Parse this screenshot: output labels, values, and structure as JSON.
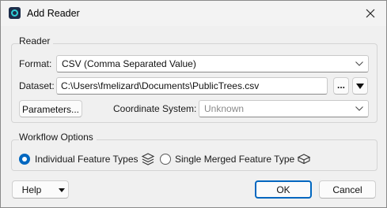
{
  "window": {
    "title": "Add Reader",
    "close_icon": "close-icon",
    "app_icon": "fme-app-icon"
  },
  "reader": {
    "group_label": "Reader",
    "format_label": "Format:",
    "format_value": "CSV (Comma Separated Value)",
    "dataset_label": "Dataset:",
    "dataset_value": "C:\\Users\\fmelizard\\Documents\\PublicTrees.csv",
    "browse_label": "...",
    "parameters_label": "Parameters...",
    "coord_label": "Coordinate System:",
    "coord_placeholder": "Unknown"
  },
  "workflow": {
    "group_label": "Workflow Options",
    "option_individual": "Individual Feature Types",
    "option_merged": "Single Merged Feature Type",
    "selected": "individual"
  },
  "footer": {
    "help_label": "Help",
    "ok_label": "OK",
    "cancel_label": "Cancel"
  },
  "colors": {
    "accent": "#0067c0",
    "background": "#f0f0f0"
  }
}
